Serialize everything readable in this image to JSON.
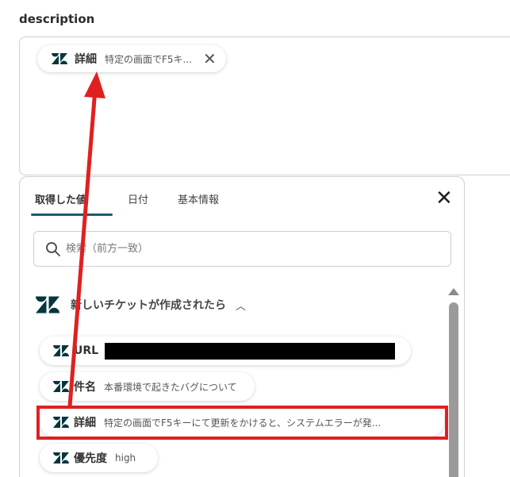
{
  "field": {
    "label": "description"
  },
  "selected_chip": {
    "label": "詳細",
    "value": "特定の画面でF5キ..."
  },
  "picker": {
    "tabs": [
      {
        "label": "取得した値"
      },
      {
        "label": "日付"
      },
      {
        "label": "基本情報"
      }
    ],
    "search_placeholder": "検索（前方一致）",
    "trigger": {
      "label": "新しいチケットが作成されたら"
    },
    "items": [
      {
        "label": "URL",
        "value": ""
      },
      {
        "label": "件名",
        "value": "本番環境で起きたバグについて"
      },
      {
        "label": "詳細",
        "value": "特定の画面でF5キーにて更新をかけると、システムエラーが発..."
      },
      {
        "label": "優先度",
        "value": "high"
      }
    ]
  },
  "colors": {
    "zendesk": "#03363d",
    "tab_accent": "#1e5a6e",
    "annotation": "#e02020"
  }
}
